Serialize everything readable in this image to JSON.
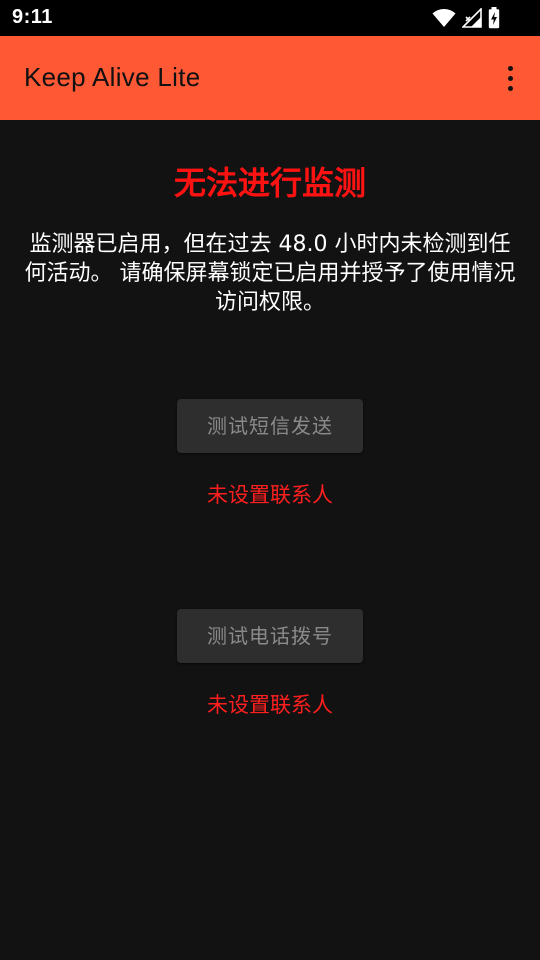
{
  "status_bar": {
    "time": "9:11",
    "icons": [
      "wifi-icon",
      "signal-icon",
      "battery-charging-icon"
    ]
  },
  "app_bar": {
    "title": "Keep Alive Lite",
    "overflow_icon": "more-vert-icon",
    "background_color": "#fe5835"
  },
  "main": {
    "warning_title": "无法进行监测",
    "warning_message": "监测器已启用，但在过去 48.0 小时内未检测到任何活动。 请确保屏幕锁定已启用并授予了使用情况访问权限。",
    "sms_test_button": "测试短信发送",
    "sms_contact_status": "未设置联系人",
    "call_test_button": "测试电话拨号",
    "call_contact_status": "未设置联系人"
  },
  "colors": {
    "background": "#121212",
    "warning": "#ff1212",
    "button_bg": "#2e2e2e",
    "button_text_disabled": "#8a8a8a"
  }
}
